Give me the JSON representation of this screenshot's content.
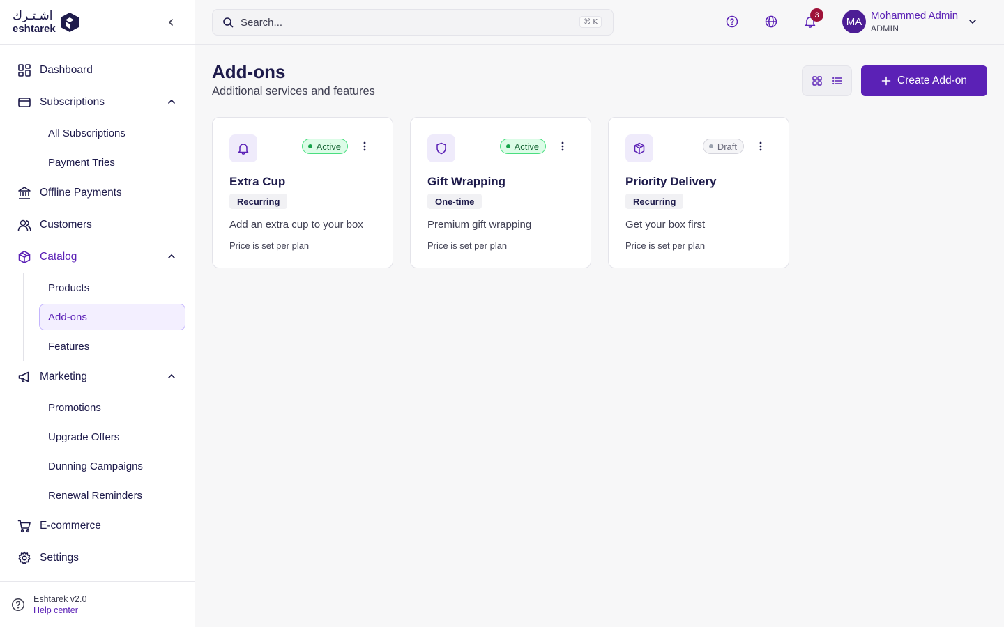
{
  "brand": {
    "name_ar": "اشـتـرك",
    "name_en": "eshtarek"
  },
  "sidebar": {
    "items": [
      {
        "label": "Dashboard"
      },
      {
        "label": "Subscriptions",
        "children": [
          "All Subscriptions",
          "Payment Tries"
        ]
      },
      {
        "label": "Offline Payments"
      },
      {
        "label": "Customers"
      },
      {
        "label": "Catalog",
        "children": [
          "Products",
          "Add-ons",
          "Features"
        ]
      },
      {
        "label": "Marketing",
        "children": [
          "Promotions",
          "Upgrade Offers",
          "Dunning Campaigns",
          "Renewal Reminders"
        ]
      },
      {
        "label": "E-commerce"
      },
      {
        "label": "Settings"
      }
    ],
    "selected_item": "Add-ons",
    "footer": {
      "version": "Eshtarek v2.0",
      "help": "Help center"
    }
  },
  "header": {
    "search_placeholder": "Search...",
    "search_shortcut": "⌘ K",
    "notification_count": "3",
    "user": {
      "initials": "MA",
      "name": "Mohammed Admin",
      "role": "ADMIN"
    }
  },
  "page": {
    "title": "Add-ons",
    "subtitle": "Additional services and features",
    "create_label": "Create Add-on"
  },
  "cards": [
    {
      "title": "Extra Cup",
      "status": "Active",
      "type": "Recurring",
      "description": "Add an extra cup to your box",
      "price_note": "Price is set per plan",
      "icon": "bell-icon"
    },
    {
      "title": "Gift Wrapping",
      "status": "Active",
      "type": "One-time",
      "description": "Premium gift wrapping",
      "price_note": "Price is set per plan",
      "icon": "shield-icon"
    },
    {
      "title": "Priority Delivery",
      "status": "Draft",
      "type": "Recurring",
      "description": "Get your box first",
      "price_note": "Price is set per plan",
      "icon": "box-icon"
    }
  ],
  "colors": {
    "primary": "#5b21b6",
    "navy": "#1e1b4b",
    "active_green": "#16a34a",
    "notification_red": "#9f1239"
  }
}
